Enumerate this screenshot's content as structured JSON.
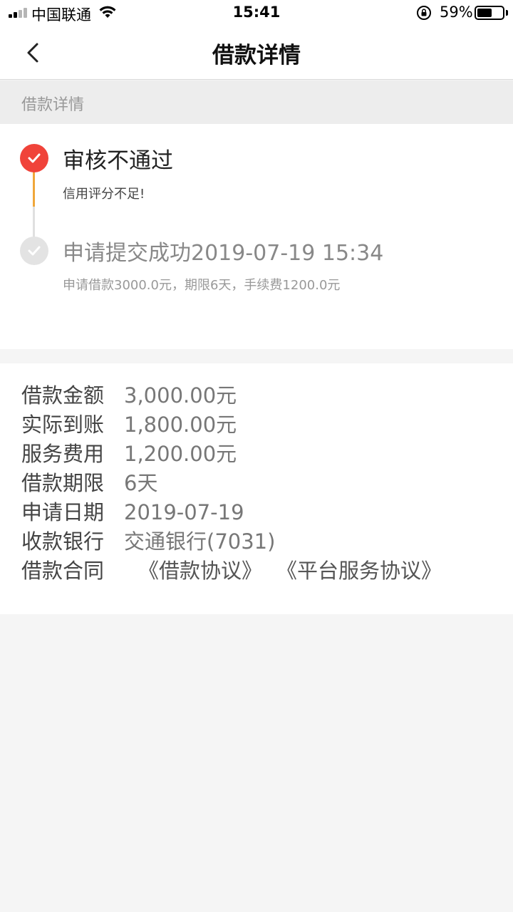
{
  "status_bar": {
    "carrier": "中国联通",
    "time": "15:41",
    "battery_percent": "59%",
    "battery_level": 0.59
  },
  "nav": {
    "title": "借款详情"
  },
  "section": {
    "header": "借款详情"
  },
  "timeline": {
    "steps": [
      {
        "title": "审核不通过",
        "desc": "信用评分不足!",
        "status": "rejected",
        "color": "#f0433a"
      },
      {
        "title": "申请提交成功2019-07-19 15:34",
        "desc": "申请借款3000.0元，期限6天，手续费1200.0元",
        "status": "done",
        "color": "#e3e3e3"
      }
    ]
  },
  "details": {
    "rows": [
      {
        "label": "借款金额",
        "value": "3,000.00元"
      },
      {
        "label": "实际到账",
        "value": "1,800.00元"
      },
      {
        "label": "服务费用",
        "value": "1,200.00元"
      },
      {
        "label": "借款期限",
        "value": "6天"
      },
      {
        "label": "申请日期",
        "value": "2019-07-19"
      },
      {
        "label": "收款银行",
        "value": "交通银行(7031)"
      }
    ],
    "contract": {
      "label": "借款合同",
      "links": [
        "《借款协议》",
        "《平台服务协议》"
      ]
    }
  },
  "colors": {
    "accent_red": "#f0433a",
    "line_orange": "#f0a73a"
  }
}
